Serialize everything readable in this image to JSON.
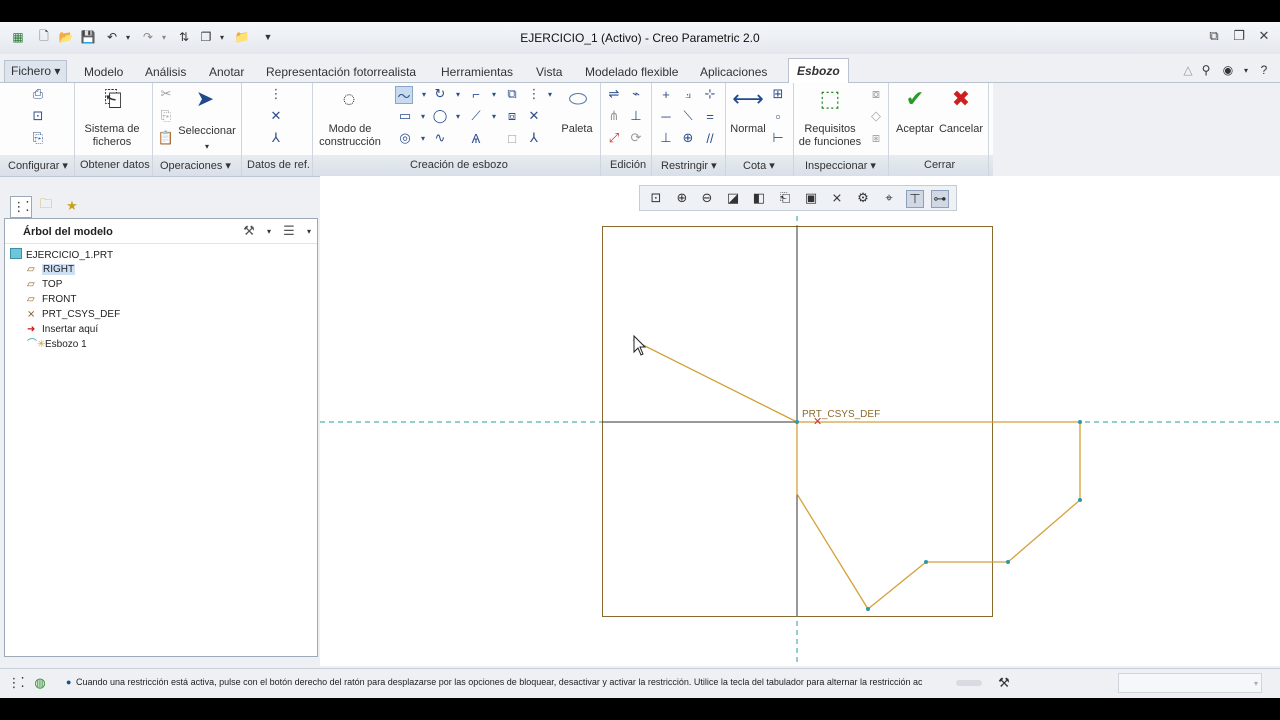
{
  "window": {
    "title": "EJERCICIO_1 (Activo) - Creo Parametric 2.0"
  },
  "tabs": [
    {
      "label": "Fichero ▾"
    },
    {
      "label": "Modelo"
    },
    {
      "label": "Análisis"
    },
    {
      "label": "Anotar"
    },
    {
      "label": "Representación fotorrealista"
    },
    {
      "label": "Herramientas"
    },
    {
      "label": "Vista"
    },
    {
      "label": "Modelado flexible"
    },
    {
      "label": "Aplicaciones"
    },
    {
      "label": "Esbozo"
    }
  ],
  "ribbon": {
    "buttons": {
      "sistema_ficheros": "Sistema de\nficheros",
      "seleccionar": "Seleccionar",
      "modo_construccion": "Modo de\nconstrucción",
      "paleta": "Paleta",
      "normal": "Normal",
      "requisitos": "Requisitos\nde funciones",
      "aceptar": "Aceptar",
      "cancelar": "Cancelar"
    },
    "groups": {
      "configurar": "Configurar ▾",
      "obtener_datos": "Obtener datos",
      "operaciones": "Operaciones ▾",
      "datos_ref": "Datos de ref.",
      "creacion_esbozo": "Creación de esbozo",
      "edicion": "Edición",
      "restringir": "Restringir ▾",
      "cota": "Cota ▾",
      "inspeccionar": "Inspeccionar ▾",
      "cerrar": "Cerrar"
    }
  },
  "model_tree": {
    "header": "Árbol del modelo",
    "items": [
      {
        "label": "EJERCICIO_1.PRT",
        "icon": "part-icon"
      },
      {
        "label": "RIGHT",
        "icon": "datum-plane-icon"
      },
      {
        "label": "TOP",
        "icon": "datum-plane-icon"
      },
      {
        "label": "FRONT",
        "icon": "datum-plane-icon"
      },
      {
        "label": "PRT_CSYS_DEF",
        "icon": "csys-icon"
      },
      {
        "label": "Insertar aquí",
        "icon": "insert-arrow-icon"
      },
      {
        "label": "Esbozo 1",
        "icon": "sketch-icon"
      }
    ]
  },
  "graphics": {
    "csys_label": "PRT_CSYS_DEF"
  },
  "status": {
    "message": "Cuando una restricción está activa, pulse con el botón derecho del ratón para desplazarse por las opciones de bloquear, desactivar y activar la restricción. Utilice la tecla del tabulador para alternar la restricción act"
  },
  "colors": {
    "sketch_line": "#d4a13a",
    "datum_axis": "#2a9aa6",
    "accept": "#2a9a2a",
    "cancel": "#cc1f1f"
  }
}
